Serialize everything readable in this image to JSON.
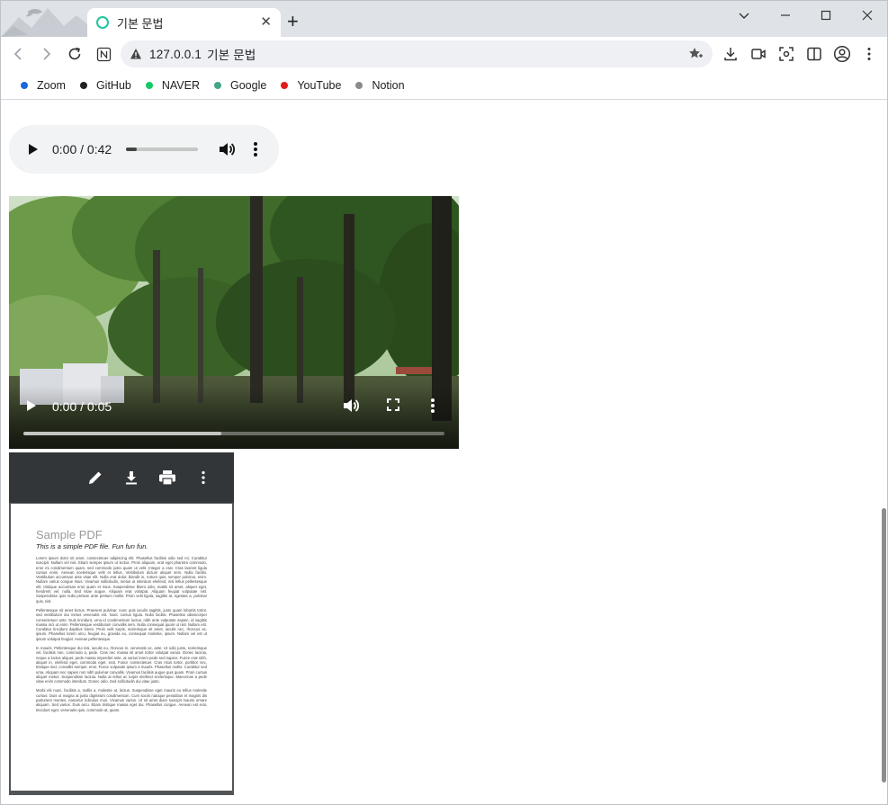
{
  "browser": {
    "tab_title": "기본 문법",
    "new_tab_label": "+",
    "address": "127.0.0.1",
    "address_title": "기본 문법"
  },
  "bookmarks": [
    {
      "label": "Zoom",
      "color": "#1a66e0"
    },
    {
      "label": "GitHub",
      "color": "#222222"
    },
    {
      "label": "NAVER",
      "color": "#17c964"
    },
    {
      "label": "Google",
      "color": "#43a48a"
    },
    {
      "label": "YouTube",
      "color": "#e51b1b"
    },
    {
      "label": "Notion",
      "color": "#8a8a8a"
    }
  ],
  "audio": {
    "time": "0:00 / 0:42",
    "progress": 0.15
  },
  "video": {
    "time": "0:00 / 0:05"
  },
  "pdf": {
    "title": "Sample PDF",
    "subtitle": "This is a simple PDF file. Fun fun fun.",
    "paragraphs": [
      "Lorem ipsum dolor sit amet, consectetuer adipiscing elit. Phasellus facilisis odio sed mi. Curabitur suscipit. Nullam vel nisi. Etiam semper ipsum ut lectus. Proin aliquam, erat eget pharetra commodo, eros mi condimentum quam, sed commodo justo quam ut velit. Integer a erat. Cras laoreet ligula cursus enim. Aenean scelerisque velit et tellus. Vestibulum dictum aliquet sem. Nulla facilisi. Vestibulum accumsan ante vitae elit. Nulla erat dolor, blandit in, rutrum quis, semper pulvinar, enim. Nullam varius congue risus. Vivamus sollicitudin, metus ut interdum eleifend, nisi tellus pellentesque elit, tristique accumsan eros quam et risus. Suspendisse libero odio, mattis sit amet, aliquet eget, hendrerit vel, nulla. Sed vitae augue. Aliquam erat volutpat. Aliquam feugiat vulputate nisl. Suspendisse quis nulla pretium ante pretium mollis. Proin velit ligula, sagittis at, egestas a, pulvinar quis, nisl.",
      "Pellentesque sit amet lectus. Praesent pulvinar, nunc quis iaculis sagittis, justo quam lobortis tortor, sed vestibulum dui metus venenatis est. Nunc cursus ligula. Nulla facilisi. Phasellus ullamcorper consectetuer ante. Duis tincidunt, urna id condimentum luctus, nibh ante vulputate sapien, id sagittis massa orci ut enim. Pellentesque vestibulum convallis sem. Nulla consequat quam ut nisl. Nullam est. Curabitur tincidunt dapibus lorem. Proin velit turpis, scelerisque sit amet, iaculis nec, rhoncus ac, ipsum. Phasellus lorem arcu, feugiat eu, gravida eu, consequat molestie, ipsum. Nullam vel est ut ipsum volutpat feugiat. Aenean pellentesque.",
      "In mauris. Pellentesque dui nisi, iaculis eu, rhoncus in, venenatis ac, ante. Ut odio justo, scelerisque vel, facilisis non, commodo a, pede. Cras nec massa sit amet tortor volutpat varius. Donec lacinia, neque a luctus aliquet, pede massa imperdiet ante, at varius lorem pede sed sapien. Fusce erat nibh, aliquet in, eleifend eget, commodo eget, erat. Fusce consectetuer. Cras risus tortor, porttitor nec, tristique sed, convallis semper, eros. Fusce vulputate ipsum a mauris. Phasellus mollis. Curabitur sed urna. Aliquam nec sapien non nibh pulvinar convallis. Vivamus facilisis augue quis quam. Proin cursus aliquet metus. Suspendisse lacinia. Nulla at tellus ac turpis eleifend scelerisque. Maecenas a pede vitae enim commodo interdum. Donec odio. Sed sollicitudin dui vitae justo.",
      "Morbi elit nunc, facilisis a, mollis a, molestie at, lectus. Suspendisse eget mauris eu tellus molestie cursus. Duis ut magna at justo dignissim condimentum. Cum sociis natoque penatibus et magnis dis parturient montes, nascetur ridiculus mus. Vivamus varius. Ut sit amet diam suscipit mauris ornare aliquam. Sed varius. Duis arcu. Etiam tristique massa eget dui. Phasellus congue. Aenean est erat, tincidunt eget, venenatis quis, commodo at, quam."
    ]
  }
}
